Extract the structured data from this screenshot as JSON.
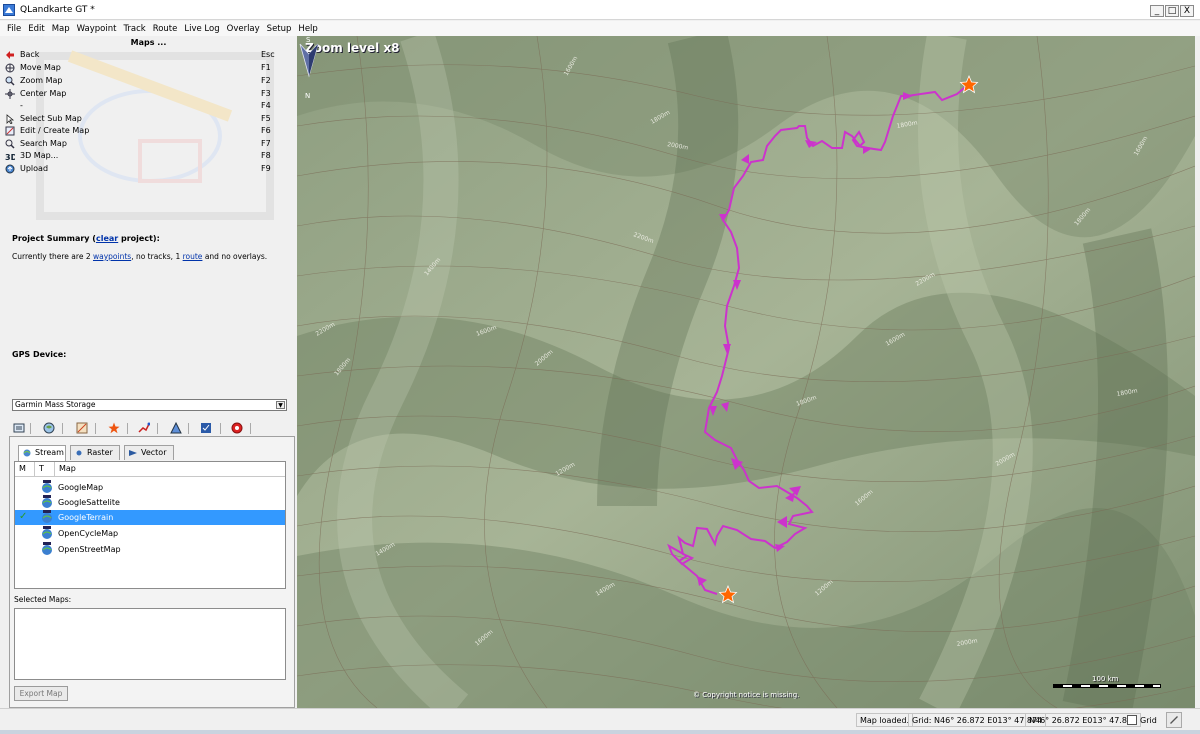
{
  "window": {
    "title": "QLandkarte GT *",
    "minimize_glyph": "_",
    "maximize_glyph": "□",
    "close_glyph": "X"
  },
  "menu": {
    "items": [
      "File",
      "Edit",
      "Map",
      "Waypoint",
      "Track",
      "Route",
      "Live Log",
      "Overlay",
      "Setup",
      "Help"
    ]
  },
  "maps_panel": {
    "title": "Maps ...",
    "commands": [
      {
        "label": "Back",
        "key": "Esc",
        "icon": "back-arrow-icon"
      },
      {
        "label": "Move Map",
        "key": "F1",
        "icon": "move-icon"
      },
      {
        "label": "Zoom Map",
        "key": "F2",
        "icon": "zoom-icon"
      },
      {
        "label": "Center Map",
        "key": "F3",
        "icon": "center-icon"
      },
      {
        "label": "-",
        "key": "F4",
        "icon": ""
      },
      {
        "label": "Select Sub Map",
        "key": "F5",
        "icon": "select-icon"
      },
      {
        "label": "Edit / Create Map",
        "key": "F6",
        "icon": "edit-map-icon"
      },
      {
        "label": "Search Map",
        "key": "F7",
        "icon": "search-map-icon"
      },
      {
        "label": "3D Map...",
        "key": "F8",
        "icon": "3d-map-icon"
      },
      {
        "label": "Upload",
        "key": "F9",
        "icon": "upload-icon"
      }
    ]
  },
  "project": {
    "title_prefix": "Project Summary (",
    "clear_link": "clear",
    "title_suffix": " project):",
    "text_1": "Currently there are 2 ",
    "waypoints_link": "waypoints",
    "text_2": ", no tracks, 1 ",
    "route_link": "route",
    "text_3": " and no overlays."
  },
  "gps": {
    "title": "GPS Device:",
    "selected": "Garmin Mass Storage"
  },
  "tabs": [
    {
      "label": "Stream",
      "active": true
    },
    {
      "label": "Raster",
      "active": false
    },
    {
      "label": "Vector",
      "active": false
    }
  ],
  "map_list": {
    "columns": [
      "M",
      "T",
      "Map"
    ],
    "rows": [
      {
        "label": "GoogleMap",
        "selected": false
      },
      {
        "label": "GoogleSattelite",
        "selected": false
      },
      {
        "label": "GoogleTerrain",
        "selected": true
      },
      {
        "label": "OpenCycleMap",
        "selected": false
      },
      {
        "label": "OpenStreetMap",
        "selected": false
      }
    ],
    "check_glyph": "✓"
  },
  "selected_maps": {
    "label": "Selected Maps:"
  },
  "export_button": "Export Map",
  "map_view": {
    "zoom_label": "Zoom level x8",
    "copyright": "© Copyright notice is missing.",
    "scale_label": "100 km",
    "north_label_top": "S",
    "north_label_bottom": "N",
    "route_color": "#cc33cc",
    "waypoint_color": "#ff6600",
    "contour_labels": [
      "1800m",
      "2000m",
      "1600m",
      "2200m",
      "1800m",
      "1400m",
      "1600m",
      "2000m",
      "1800m",
      "1200m",
      "1600m",
      "1400m",
      "2200m",
      "1800m",
      "1600m",
      "2000m",
      "1800m",
      "1400m",
      "1200m",
      "1600m",
      "2000m",
      "1800m",
      "1600m",
      "2200m"
    ]
  },
  "status": {
    "message": "Map loaded.",
    "grid_coords": "Grid: N46° 26.872 E013° 47.874",
    "coords": "N46° 26.872 E013° 47.874",
    "grid_label": "Grid"
  }
}
